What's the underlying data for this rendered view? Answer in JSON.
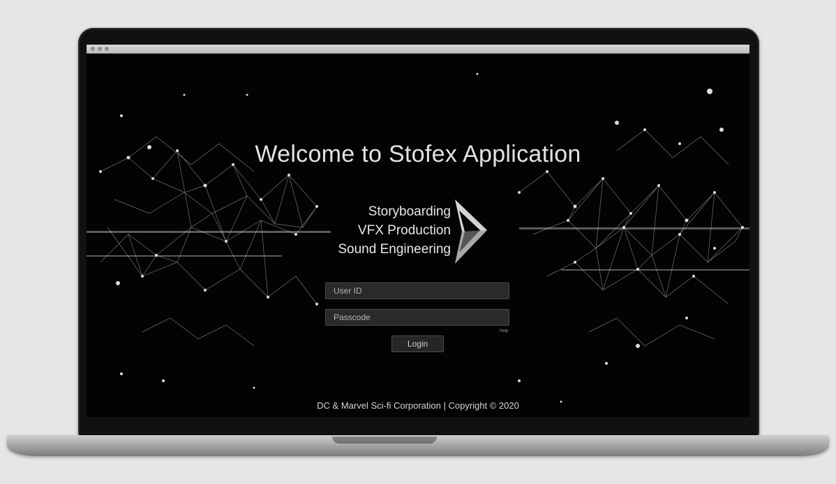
{
  "app": {
    "title": "Welcome to Stofex Application",
    "services": [
      "Storyboarding",
      "VFX Production",
      "Sound Engineering"
    ],
    "logo_icon": "play-triangle-logo-icon"
  },
  "login_form": {
    "user_id_placeholder": "User ID",
    "passcode_placeholder": "Passcode",
    "help_label": "Help",
    "login_label": "Login"
  },
  "footer": {
    "copyright": "DC & Marvel Sci-fi Corporation | Copyright © 2020"
  },
  "colors": {
    "background": "#030303",
    "text": "#e2e2e2",
    "field_bg": "#2a2a2a",
    "frame": "#111111"
  }
}
